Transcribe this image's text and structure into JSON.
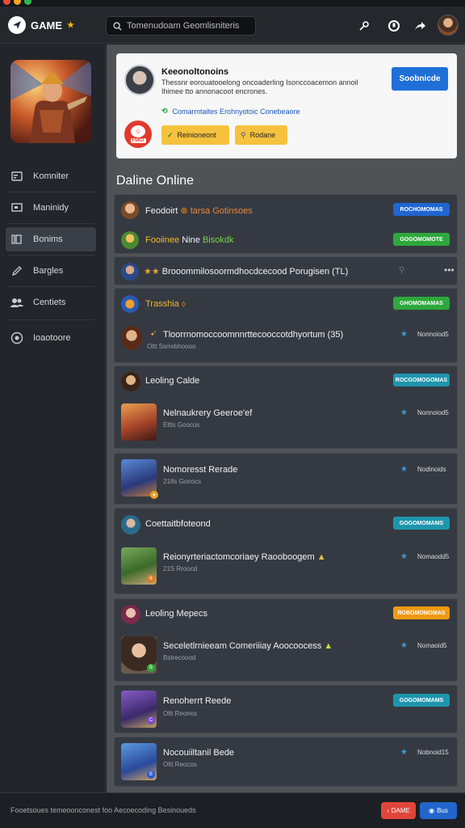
{
  "window": {
    "controls": [
      {
        "color": "#e94b3c"
      },
      {
        "color": "#f5a623"
      },
      {
        "color": "#2dbb4e"
      }
    ]
  },
  "topbar": {
    "logo": "GAME",
    "search_placeholder": "Tomenudoam Geomlisniteris",
    "icons": [
      "key-icon",
      "status-icon",
      "share-icon"
    ]
  },
  "sidebar": {
    "items": [
      {
        "label": "Komniter",
        "icon": "keyboard-icon"
      },
      {
        "label": "Maninidy",
        "icon": "monitor-icon"
      },
      {
        "label": "Bonims",
        "icon": "library-icon",
        "active": true
      },
      {
        "label": "Bargles",
        "icon": "pencil-icon"
      },
      {
        "label": "Centiets",
        "icon": "people-icon"
      },
      {
        "label": "Ioaotoore",
        "icon": "info-icon"
      }
    ]
  },
  "card": {
    "title": "Keeonoltonoins",
    "description": "Thessnr eorouatooelong oncoaderling  Isonccoacemon  annoil  Ihimee tto annonacoot encrones.",
    "button": "Soobnicde",
    "link_text": "Comarmtaites Erohnyotoic Conebeaore",
    "pill1": "Reinioneont",
    "pill2": "Rodane",
    "badge_tag": "FMIO"
  },
  "section_title": "Daline Online",
  "status_colors": {
    "blue": "#1f66d1",
    "green": "#2ea83c",
    "teal": "#1f95ad",
    "orange": "#ef9a14"
  },
  "friends": [
    {
      "name": "Feodoirt",
      "extra": "tarsa",
      "extra2": "Gotinsoes",
      "status": "ROCHOMOMAS"
    },
    {
      "name": "Fooiinee",
      "extra": "Nine",
      "extra2": "Bisokdk",
      "status": "GOGOMOMOTE"
    },
    {
      "name": "Brooommilosoormdhocdcecood Porugisen (TL)",
      "prefix": "★★"
    },
    {
      "name": "Trasshia",
      "status": "GHOMOMAMAS"
    },
    {
      "name": "Tloorrnomoccoomnnrttecooccotdhyortum (35)",
      "sub": "Oltt Ssrrebhoooo",
      "slabel": "Nonnoiod5"
    },
    {
      "name": "Leoling Calde",
      "status": "ROCGOMOGOMAS"
    },
    {
      "name": "Nelnaukrery Geeroe'ef",
      "sub": "Eltts Goocos",
      "slabel": "Nonnoiod5"
    },
    {
      "name": "Nomoresst Rerade",
      "sub": "218s Gonocs",
      "slabel": "Nodinoids"
    },
    {
      "name": "Coettaitbfoteond",
      "status": "GOGOMOMAMS"
    },
    {
      "name": "Reionyrteriactomcoriaey Raooboogem",
      "sub": "21S Rroocd",
      "slabel": "Nomaodd5"
    },
    {
      "name": "Leoling Mepecs",
      "status": "ROBOMOMOMAS"
    },
    {
      "name": "Seceletlrnieeam Comeriiiay Aoocoocess",
      "sub": "Bstrecoood",
      "slabel": "Nomaoid5"
    },
    {
      "name": "Renoherrt Reede",
      "sub": "Oltt Reonos",
      "status": "GOGOMOMAMS"
    },
    {
      "name": "Nocouiiltanil Bede",
      "sub": "Oltt Reocos",
      "slabel": "Nobnoid15"
    }
  ],
  "footer": {
    "text": "Fooetsoues temeoonconest foo Aecoecoding Besinoueds",
    "btn1": "DAME",
    "btn2": "Bus",
    "btn1_color": "#e0453a",
    "btn2_color": "#2265cc"
  }
}
